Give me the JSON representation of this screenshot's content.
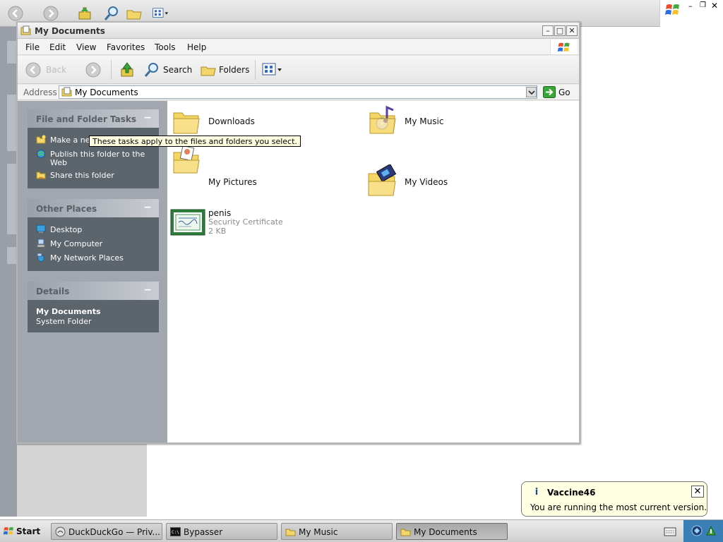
{
  "window": {
    "title": "My Documents",
    "menu": [
      "File",
      "Edit",
      "View",
      "Favorites",
      "Tools",
      "Help"
    ]
  },
  "toolbar": {
    "back_label": "Back",
    "search_label": "Search",
    "folders_label": "Folders"
  },
  "address": {
    "label": "Address",
    "value": "My Documents",
    "go_label": "Go"
  },
  "taskpane": {
    "file_folder_tasks": {
      "title": "File and Folder Tasks",
      "items": [
        "Make a new folder",
        "Publish this folder to the",
        "Web",
        "Share this folder"
      ]
    },
    "other_places": {
      "title": "Other Places",
      "items": [
        "Desktop",
        "My Computer",
        "My Network Places"
      ]
    },
    "details": {
      "title": "Details",
      "name": "My Documents",
      "type": "System Folder"
    },
    "collapse_glyph": "−"
  },
  "tooltip": "These tasks apply to the files and folders you select.",
  "content": {
    "items": [
      {
        "name": "Downloads"
      },
      {
        "name": "My Music"
      },
      {
        "name": "My Pictures"
      },
      {
        "name": "My Videos"
      },
      {
        "name": "penis",
        "type": "Security Certificate",
        "size": "2 KB"
      }
    ]
  },
  "balloon": {
    "info_glyph": "i",
    "title": "Vaccine46",
    "text": "You are running the most current version.",
    "close_glyph": "✕"
  },
  "taskbar": {
    "start_label": "Start",
    "tasks": [
      "DuckDuckGo — Priv...",
      "Bypasser",
      "My Music",
      "My Documents"
    ]
  },
  "colors": {
    "taskpane_bg": "#a2a6ae",
    "panel_body": "#5c646c",
    "tooltip_bg": "#ffffe1",
    "tray": "#3a7fb6"
  }
}
